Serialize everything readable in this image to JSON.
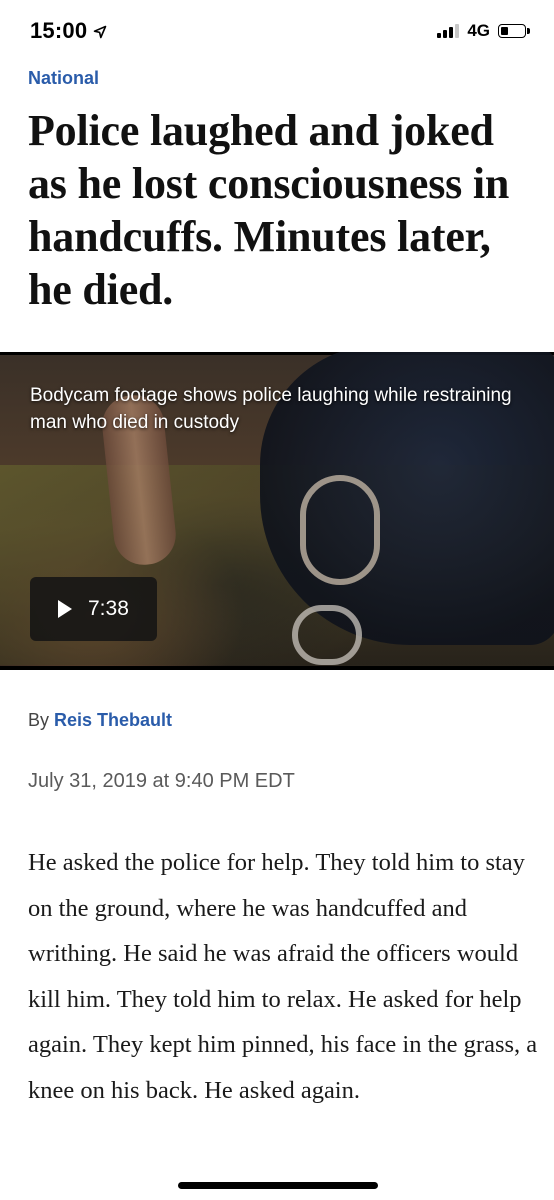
{
  "status_bar": {
    "time": "15:00",
    "network": "4G"
  },
  "article": {
    "section": "National",
    "headline": "Police laughed and joked as he lost consciousness in handcuffs. Minutes later, he died.",
    "video": {
      "caption": "Bodycam footage shows police laughing while restraining man who died in custody",
      "duration": "7:38"
    },
    "byline_prefix": "By",
    "author": "Reis Thebault",
    "date": "July 31, 2019 at 9:40 PM EDT",
    "body": "He asked the police for help. They told him to stay on the ground, where he was handcuffed and writhing. He said he was afraid the officers would kill him. They told him to relax. He asked for help again. They kept him pinned, his face in the grass, a knee on his back. He asked again."
  },
  "colors": {
    "link_blue": "#2a5caa",
    "text": "#111111"
  }
}
